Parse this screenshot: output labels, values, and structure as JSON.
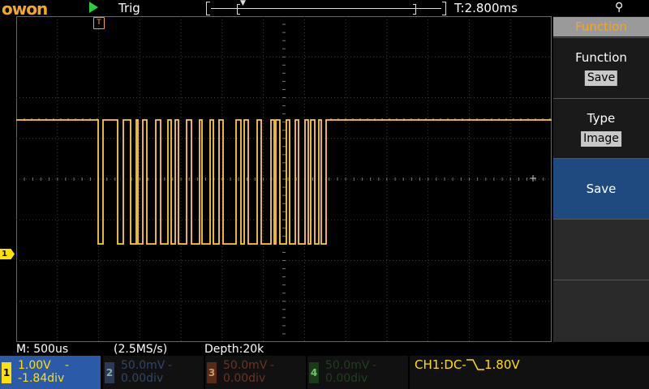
{
  "top": {
    "logo": "OWON",
    "status": "Trig",
    "time_delay": "T:2.800ms"
  },
  "markers": {
    "trigger": "T",
    "ch1": "1"
  },
  "info": {
    "timebase": "M: 500us",
    "sample_rate": "(2.5MS/s)",
    "depth": "Depth:20k"
  },
  "channels": [
    {
      "num": "1",
      "volts": "1.00V",
      "pos": "-1.84div",
      "suffix": "-",
      "color": "#ffe000",
      "text_color": "#ffe000"
    },
    {
      "num": "2",
      "volts": "50.0mV",
      "pos": "0.00div",
      "suffix": "-",
      "color": "#3a8fd8",
      "text_color": "#2a3a55"
    },
    {
      "num": "3",
      "volts": "50.0mV",
      "pos": "0.00div",
      "suffix": "-",
      "color": "#e0602a",
      "text_color": "#5a2a18"
    },
    {
      "num": "4",
      "volts": "50.0mV",
      "pos": "0.00div",
      "suffix": "-",
      "color": "#2ecc40",
      "text_color": "#1a3a1a"
    }
  ],
  "trigger_info": {
    "coupling": "CH1:DC-",
    "level": "1.80V"
  },
  "menu": {
    "title": "Function",
    "items": [
      {
        "label": "Function",
        "value": "Save"
      },
      {
        "label": "Type",
        "value": "Image"
      },
      {
        "label": "Save",
        "value": ""
      },
      {
        "label": "",
        "value": ""
      },
      {
        "label": "",
        "value": ""
      }
    ]
  },
  "waveform": {
    "color": "#ffcc33",
    "high_level": 148,
    "low_level": 301,
    "edges": [
      121,
      127,
      145,
      152,
      161,
      168,
      170,
      176,
      181,
      192,
      198,
      207,
      211,
      216,
      220,
      230,
      236,
      246,
      249,
      259,
      263,
      270,
      275,
      291,
      297,
      301,
      306,
      317,
      322,
      334,
      338,
      340,
      345,
      353,
      357,
      364,
      368,
      376,
      380,
      383,
      388,
      393,
      396,
      402
    ]
  },
  "colors": {
    "accent": "#f5a623",
    "ch1": "#ffe000",
    "menu_selected": "#1f4a80"
  }
}
